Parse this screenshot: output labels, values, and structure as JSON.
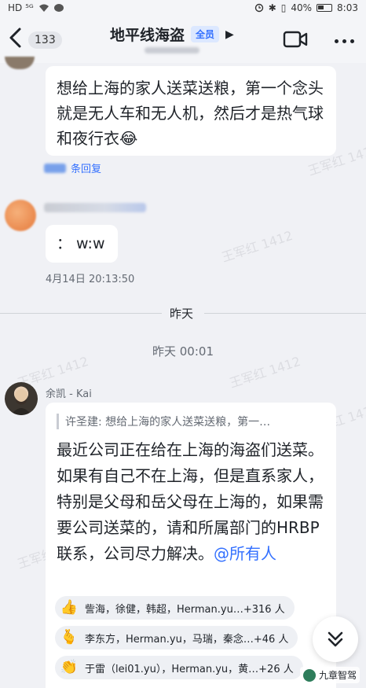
{
  "status_bar": {
    "left_indicators": "HD ⁵ᴳ",
    "battery": "40%",
    "time": "8:03"
  },
  "header": {
    "unread_count": "133",
    "title": "地平线海盗",
    "badge": "全员"
  },
  "messages": [
    {
      "text": "想给上海的家人送菜送粮，第一个念头就是无人车和无人机，然后才是热气球和夜行衣😂",
      "reply_link": "条回复"
    },
    {
      "text": "：  w:w",
      "time": "4月14日 20:13:50"
    }
  ],
  "divider": {
    "label": "昨天"
  },
  "time_separator": "昨天 00:01",
  "kai_message": {
    "sender": "余凯 - Kai",
    "quote": "许圣建: 想给上海的家人送菜送粮，第一…",
    "text": "最近公司正在给在上海的海盗们送菜。如果有自己不在上海，但是直系家人，特别是父母和岳父母在上海的，如果需要公司送菜的，请和所属部门的HRBP联系，公司尽力解决。",
    "mention": "@所有人",
    "reactions": [
      {
        "icon": "thumbs-up-icon",
        "glyph": "👍",
        "users": "訾海，徐健，韩超，Herman.yu…+316 人"
      },
      {
        "icon": "finger-heart-icon",
        "glyph": "🫰",
        "users": "李东方，Herman.yu，马瑞，秦念…+46 人"
      },
      {
        "icon": "clapping-icon",
        "glyph": "👏",
        "users": "于雷（lei01.yu），Herman.yu，黄…+26 人"
      }
    ]
  },
  "watermark": "王军红 1412",
  "brand": "九章智驾",
  "colors": {
    "background": "#f0f1f5",
    "bubble": "#ffffff",
    "accent_blue": "#3370ff",
    "muted_text": "#646a73"
  }
}
